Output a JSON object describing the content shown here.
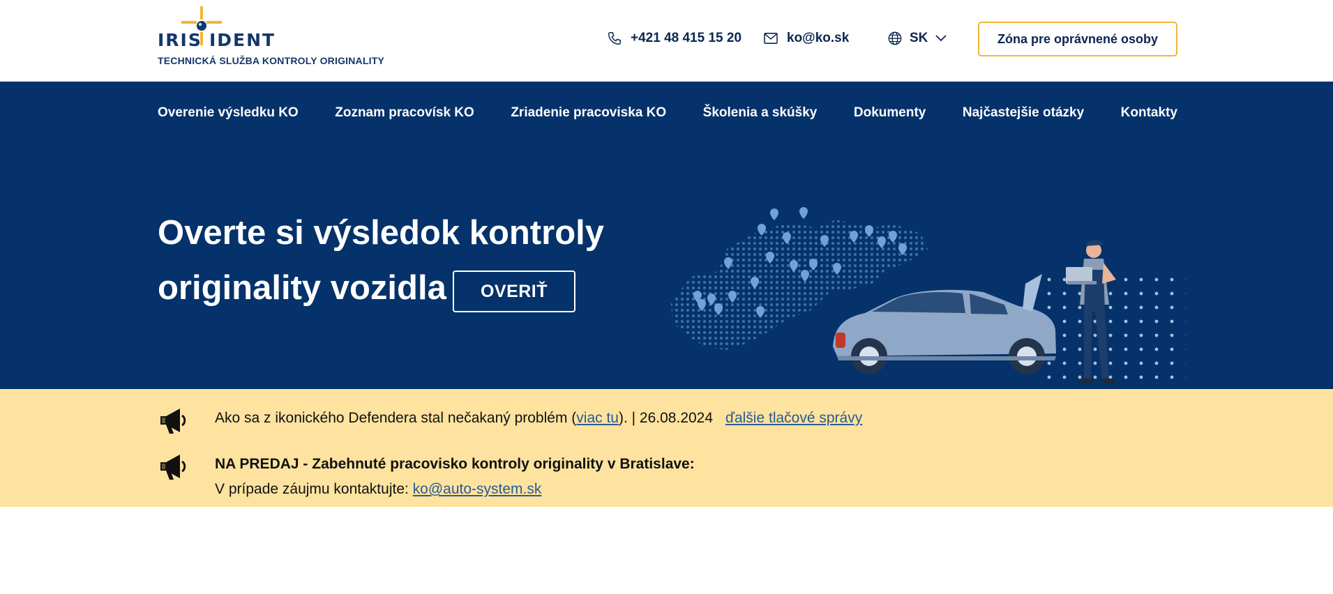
{
  "header": {
    "logo_word_left": "IRIS",
    "logo_word_right": "IDENT",
    "tagline": "TECHNICKÁ SLUŽBA KONTROLY ORIGINALITY",
    "phone": "+421 48 415 15 20",
    "email": "ko@ko.sk",
    "language": "SK",
    "zone_button": "Zóna pre oprávnené osoby"
  },
  "nav": {
    "items": [
      {
        "label": "Overenie výsledku KO"
      },
      {
        "label": "Zoznam pracovísk KO"
      },
      {
        "label": "Zriadenie pracoviska KO"
      },
      {
        "label": "Školenia a skúšky"
      },
      {
        "label": "Dokumenty"
      },
      {
        "label": "Najčastejšie otázky"
      },
      {
        "label": "Kontakty"
      }
    ]
  },
  "hero": {
    "title_line1": "Overte si výsledok kontroly",
    "title_line2": "originality vozidla",
    "verify_button": "OVERIŤ"
  },
  "notices": {
    "n1_text_before": "Ako sa z ikonického Defendera stal nečakaný problém (",
    "n1_link": "viac tu",
    "n1_text_after": "). | 26.08.2024",
    "n1_press_link": "ďalšie tlačové správy",
    "n2_title": "NA PREDAJ - Zabehnuté pracovisko kontroly originality v Bratislave:",
    "n2_text": "V prípade záujmu kontaktujte: ",
    "n2_link": "ko@auto-system.sk"
  },
  "colors": {
    "brand_navy": "#05326a",
    "accent_yellow": "#f2b632",
    "notice_bg": "#fde39f",
    "link_blue": "#2a5a92"
  }
}
